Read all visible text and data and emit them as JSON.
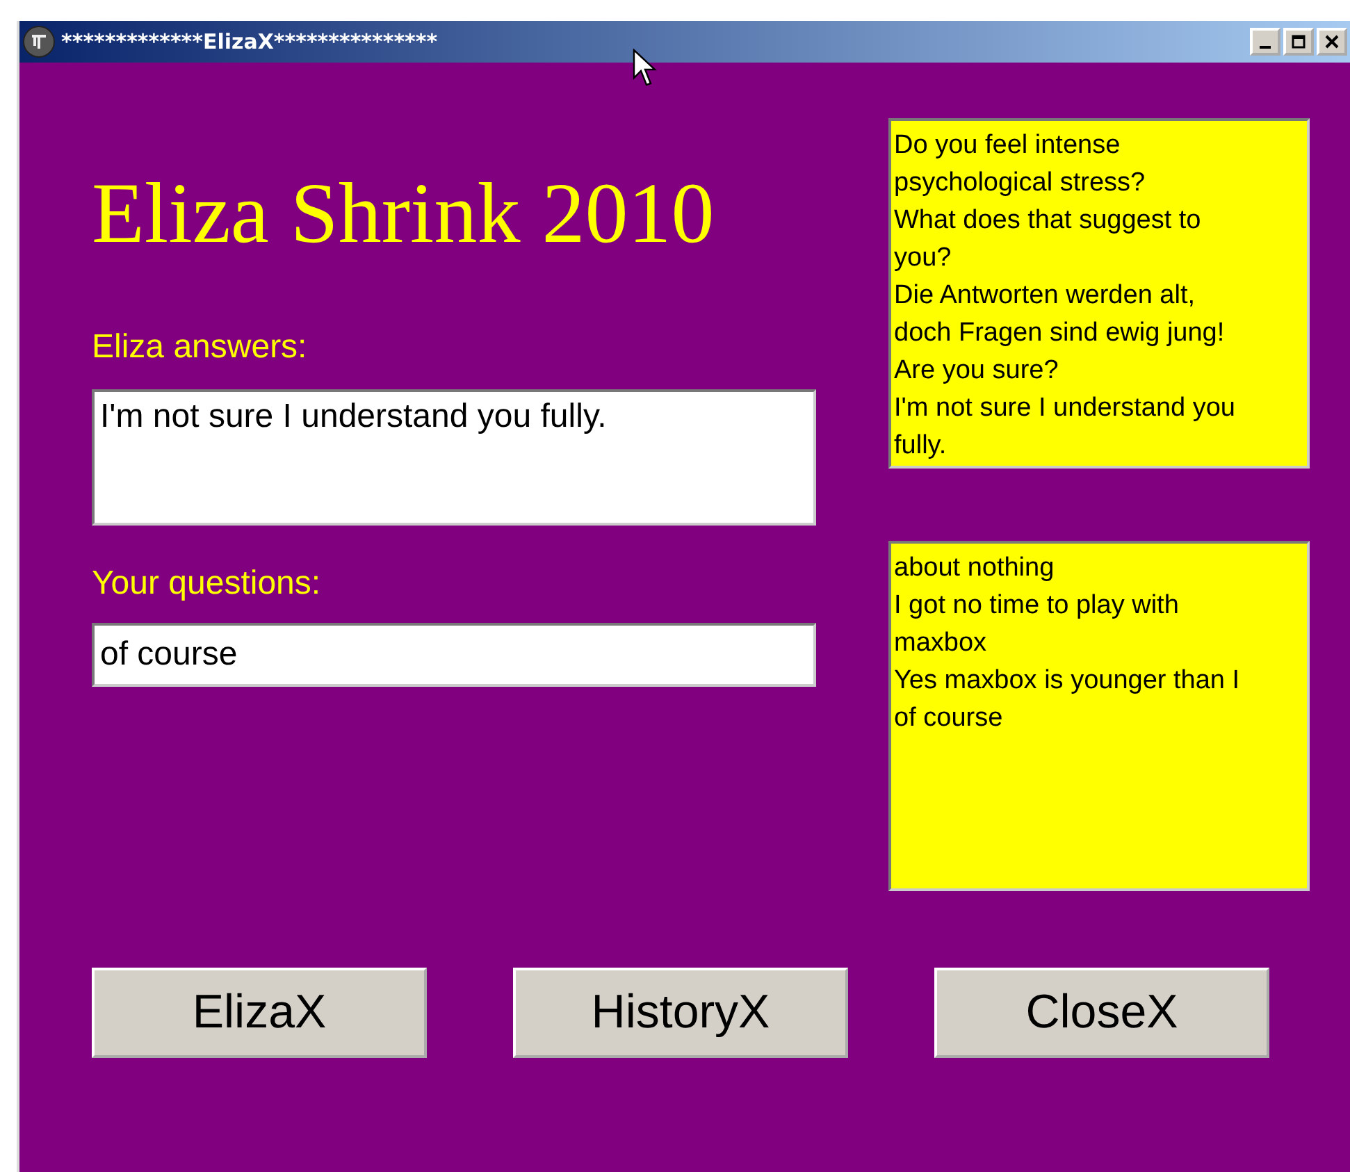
{
  "window": {
    "title": "*************ElizaX***************"
  },
  "heading": "Eliza Shrink 2010",
  "answer": {
    "label": "Eliza answers:",
    "value": "I'm not sure I understand you fully."
  },
  "question": {
    "label": "Your questions:",
    "value": "of course"
  },
  "memos": [
    [
      "Do you feel intense psychological stress?",
      "What does that suggest to you?",
      "Die Antworten werden alt, doch Fragen sind ewig jung!",
      "Are you sure?",
      "I'm not sure I understand you fully."
    ],
    [
      "about nothing",
      "I got no time to play with maxbox",
      "Yes maxbox is younger than I",
      "of course"
    ]
  ],
  "buttons": [
    "ElizaX",
    "HistoryX",
    "CloseX"
  ]
}
